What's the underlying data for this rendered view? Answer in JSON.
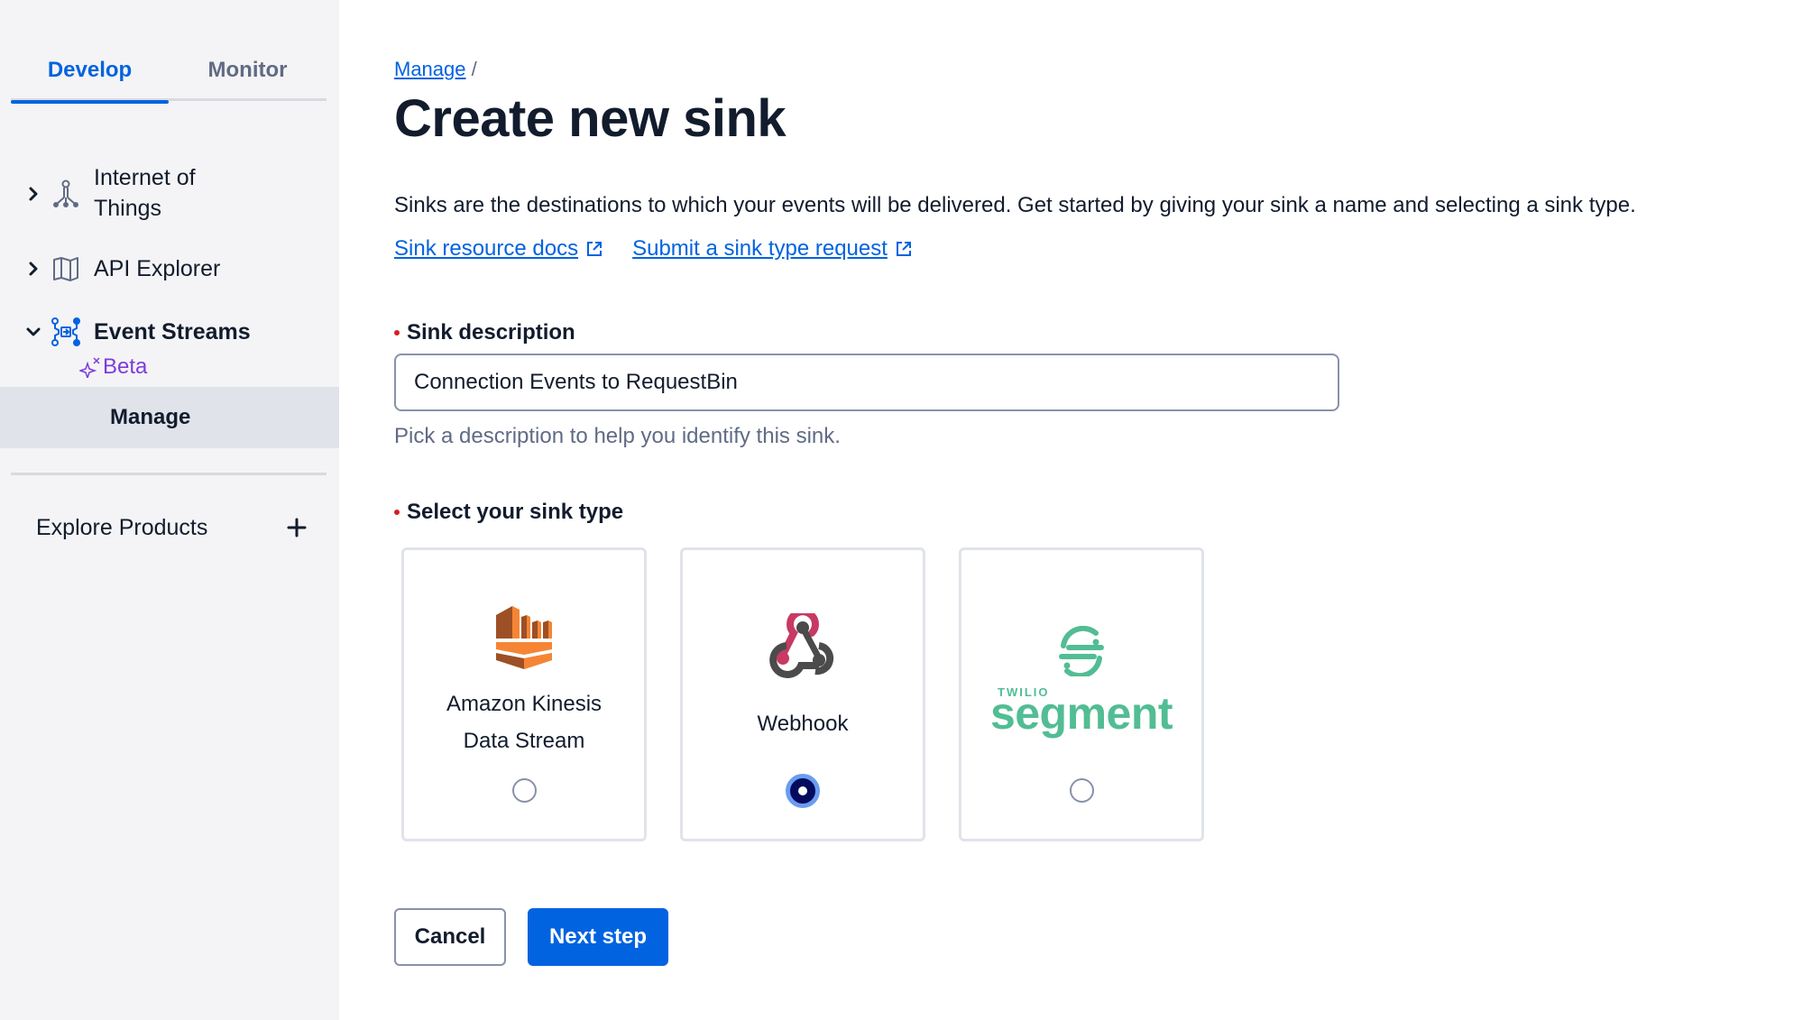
{
  "sidebar": {
    "tabs": [
      {
        "label": "Develop",
        "active": true
      },
      {
        "label": "Monitor",
        "active": false
      }
    ],
    "items": [
      {
        "label_line1": "Internet of",
        "label_line2": "Things",
        "icon": "iot-icon",
        "expanded": false
      },
      {
        "label": "API Explorer",
        "icon": "map-icon",
        "expanded": false
      },
      {
        "label": "Event Streams",
        "icon": "event-streams-icon",
        "expanded": true,
        "badge": "Beta",
        "children": [
          {
            "label": "Manage",
            "selected": true
          }
        ]
      }
    ],
    "explore": {
      "label": "Explore Products",
      "icon": "plus-icon"
    }
  },
  "main": {
    "breadcrumb": {
      "link": "Manage",
      "separator": "/"
    },
    "title": "Create new sink",
    "intro": "Sinks are the destinations to which your events will be delivered. Get started by giving your sink a name and selecting a sink type.",
    "links": [
      {
        "label": "Sink resource docs",
        "icon": "external-link-icon"
      },
      {
        "label": "Submit a sink type request",
        "icon": "external-link-icon"
      }
    ],
    "description_field": {
      "label": "Sink description",
      "required": true,
      "value": "Connection Events to RequestBin",
      "help": "Pick a description to help you identify this sink."
    },
    "sink_type_field": {
      "label": "Select your sink type",
      "required": true,
      "options": [
        {
          "label_line1": "Amazon Kinesis",
          "label_line2": "Data Stream",
          "icon": "kinesis-logo",
          "selected": false
        },
        {
          "label": "Webhook",
          "icon": "webhook-logo",
          "selected": true
        },
        {
          "label": "Twilio Segment",
          "logo_small": "TWILIO",
          "logo_text": "segment",
          "icon": "segment-logo",
          "selected": false
        }
      ]
    },
    "buttons": {
      "cancel": "Cancel",
      "next": "Next step"
    }
  },
  "colors": {
    "brand_blue": "#0263e0",
    "text": "#121c2d",
    "muted": "#606b85",
    "beta_purple": "#7d3cdb",
    "segment_green": "#52bd94",
    "required_red": "#d61f1f",
    "sidebar_bg": "#f4f4f6",
    "selected_nav_bg": "#e1e3ea"
  }
}
